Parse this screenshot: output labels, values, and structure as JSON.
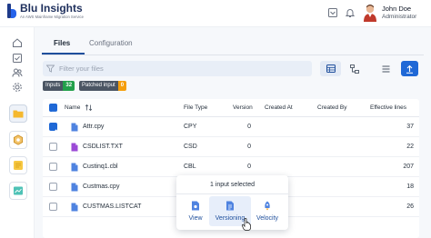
{
  "app": {
    "name": "Blu Insights",
    "tagline": "An AWS Mainframe Migration Service"
  },
  "user": {
    "name": "John Doe",
    "role": "Administrator"
  },
  "tabs": [
    {
      "label": "Files",
      "active": true
    },
    {
      "label": "Configuration",
      "active": false
    }
  ],
  "filter": {
    "placeholder": "Filter your files"
  },
  "badges": [
    {
      "label": "Inputs",
      "count": "32",
      "color": "#22a04b"
    },
    {
      "label": "Patched input",
      "count": "0",
      "color": "#f59e0b"
    }
  ],
  "table": {
    "columns": [
      "Name",
      "File Type",
      "Version",
      "Created At",
      "Created By",
      "Effective lines"
    ],
    "rows": [
      {
        "name": "Attr.cpy",
        "type": "CPY",
        "version": "0",
        "created_at": "",
        "created_by": "",
        "lines": "37",
        "checked": true,
        "icon": "file-icon",
        "icon_color": "#4f83e0"
      },
      {
        "name": "CSDLIST.TXT",
        "type": "CSD",
        "version": "0",
        "created_at": "",
        "created_by": "",
        "lines": "22",
        "checked": false,
        "icon": "file-icon",
        "icon_color": "#9b4ad6"
      },
      {
        "name": "Custinq1.cbl",
        "type": "CBL",
        "version": "0",
        "created_at": "",
        "created_by": "",
        "lines": "207",
        "checked": false,
        "icon": "file-icon",
        "icon_color": "#4f83e0"
      },
      {
        "name": "Custmas.cpy",
        "type": "",
        "version": "",
        "created_at": "",
        "created_by": "",
        "lines": "18",
        "checked": false,
        "icon": "file-icon",
        "icon_color": "#4f83e0"
      },
      {
        "name": "CUSTMAS.LISTCAT",
        "type": "",
        "version": "",
        "created_at": "",
        "created_by": "",
        "lines": "26",
        "checked": false,
        "icon": "file-icon",
        "icon_color": "#4f83e0"
      }
    ]
  },
  "selection_popover": {
    "title": "1 input selected",
    "actions": [
      {
        "label": "View",
        "icon": "view-file-icon",
        "active": false
      },
      {
        "label": "Versioning",
        "icon": "versioning-icon",
        "active": true
      },
      {
        "label": "Velocity",
        "icon": "velocity-icon",
        "active": false
      }
    ]
  },
  "colors": {
    "primary": "#1f68d6",
    "navy": "#1e2f5c",
    "inputs_badge": "#22a04b",
    "patched_badge": "#f59e0b"
  }
}
